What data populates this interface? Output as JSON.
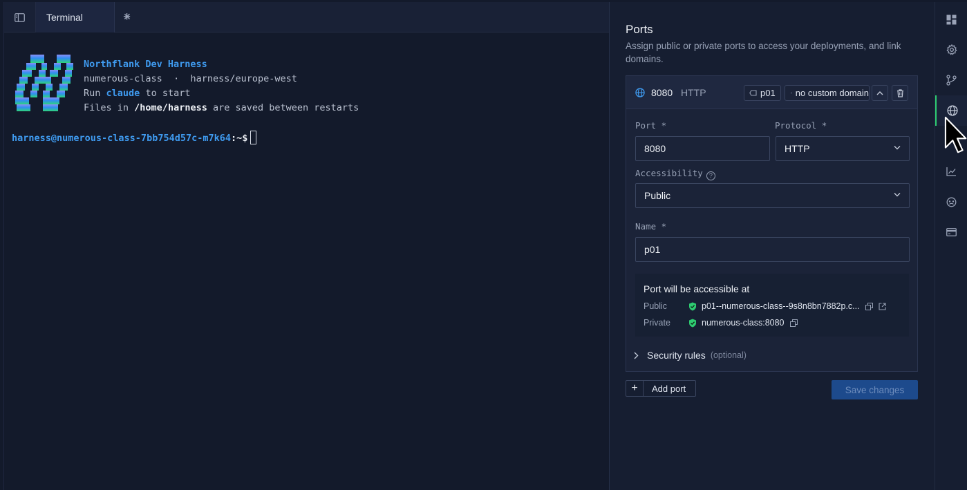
{
  "tabs": {
    "sidebar_toggle_icon": "sidebar-toggle-icon",
    "items": [
      {
        "label": "Terminal",
        "close": "✕"
      }
    ],
    "add": "+"
  },
  "terminal": {
    "banner": {
      "title": "Northflank Dev Harness",
      "project": "numerous-class",
      "dot": "·",
      "region": "harness/europe-west",
      "run_prefix": "Run",
      "run_cmd": "claude",
      "run_suffix": "to start",
      "files_prefix": "Files in",
      "files_path": "/home/harness",
      "files_suffix": "are saved between restarts"
    },
    "prompt": {
      "user_host": "harness@numerous-class-7bb754d57c-m7k64",
      "path": ":~$"
    }
  },
  "ports": {
    "title": "Ports",
    "subtitle": "Assign public or private ports to access your deployments, and link domains.",
    "card": {
      "port": "8080",
      "protocol": "HTTP",
      "tag": "p01",
      "domain": "no custom domain",
      "port_label": "Port *",
      "port_value": "8080",
      "protocol_label": "Protocol *",
      "protocol_value": "HTTP",
      "access_label": "Accessibility",
      "access_value": "Public",
      "name_label": "Name *",
      "name_value": "p01",
      "accessible_title": "Port will be accessible at",
      "public_label": "Public",
      "public_url": "p01--numerous-class--9s8n8bn7882p.c...",
      "private_label": "Private",
      "private_url": "numerous-class:8080",
      "security_label": "Security rules",
      "security_optional": "(optional)"
    },
    "add_port": "Add port",
    "save": "Save changes"
  },
  "rail": {
    "items": [
      "dashboard-icon",
      "settings-icon",
      "git-branch-icon",
      "globe-icon",
      "chart-icon",
      "logs-icon",
      "billing-icon"
    ],
    "active": "globe-icon"
  },
  "colors": {
    "accent": "#3f9bf0",
    "success": "#2ecc71",
    "save_button": "#1d4a8c"
  }
}
